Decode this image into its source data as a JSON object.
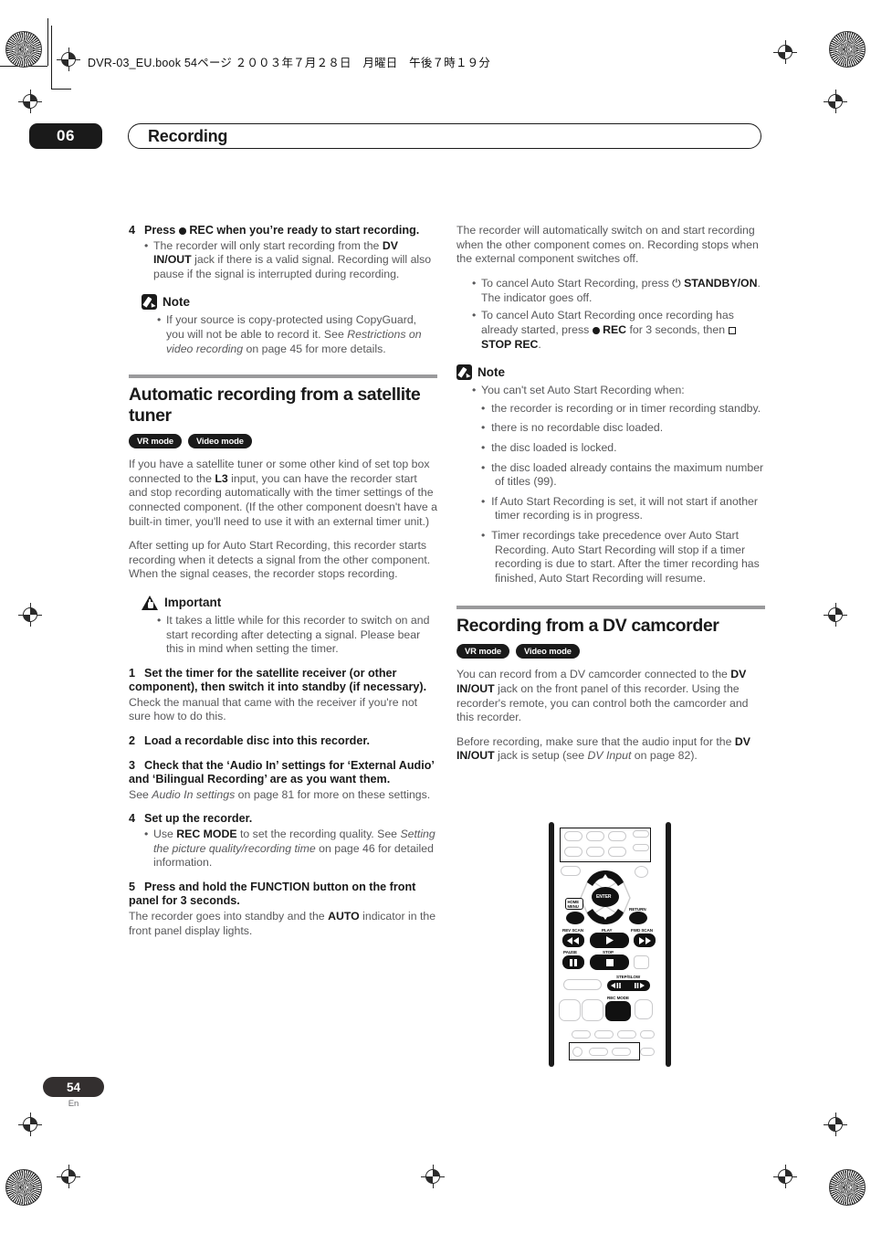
{
  "print": {
    "file_header": "DVR-03_EU.book  54ページ  ２００３年７月２８日　月曜日　午後７時１９分"
  },
  "header": {
    "chapter_number": "06",
    "chapter_title": "Recording"
  },
  "footer": {
    "page_number": "54",
    "language": "En"
  },
  "left_column": {
    "step4": {
      "number": "4",
      "title_a": "Press",
      "title_b": "REC when you’re ready to start recording.",
      "bullets": [
        "The recorder will only start recording from the DV IN/OUT jack if there is a valid signal. Recording will also pause if the signal is interrupted during recording."
      ]
    },
    "note1": {
      "label": "Note",
      "bullets": [
        "If your source is copy-protected using CopyGuard, you will not be able to record it. See Restrictions on video recording on page 45 for more details."
      ],
      "bullet1_pre": "If your source is copy-protected using CopyGuard, you will not be able to record it. See ",
      "bullet1_italic": "Restrictions on video recording",
      "bullet1_post": " on page 45 for more details."
    },
    "section": {
      "title": "Automatic recording from a satellite tuner",
      "badges": [
        "VR mode",
        "Video mode"
      ],
      "para1_a": "If you have a satellite tuner or some other kind of set top box connected to the ",
      "para1_bold": "L3",
      "para1_b": " input, you can have the recorder start and stop recording automatically with the timer settings of the connected component. (If the other component doesn't have a built-in timer, you'll need to use it with an external timer unit.)",
      "para2": "After setting up for Auto Start Recording, this recorder starts recording when it detects a signal from the other component. When the signal ceases, the recorder stops recording."
    },
    "important": {
      "label": "Important",
      "bullets": [
        "It takes a little while for this recorder to switch on and start recording after detecting a signal. Please bear this in mind when setting the timer."
      ]
    },
    "steps": [
      {
        "number": "1",
        "title": "Set the timer for the satellite receiver (or other component), then switch it into standby (if necessary).",
        "body": "Check the manual that came with the receiver if you're not sure how to do this."
      },
      {
        "number": "2",
        "title": "Load a recordable disc into this recorder.",
        "body": ""
      },
      {
        "number": "3",
        "title": "Check that the ‘Audio In’ settings for ‘External Audio’ and ‘Bilingual Recording’ are as you want them.",
        "body_pre": "See ",
        "body_italic": "Audio In settings",
        "body_post": " on page 81 for more on these settings."
      },
      {
        "number": "4",
        "title": "Set up the recorder.",
        "bullet_pre": "Use ",
        "bullet_bold": "REC MODE",
        "bullet_mid": " to set the recording quality. See ",
        "bullet_italic": "Setting the picture quality/recording time",
        "bullet_post": " on page 46 for detailed information."
      },
      {
        "number": "5",
        "title": "Press and hold the FUNCTION button on the front panel for 3 seconds.",
        "body_pre": "The recorder goes into standby and the ",
        "body_bold": "AUTO",
        "body_post": " indicator in the front panel display lights."
      }
    ]
  },
  "right_column": {
    "para1": "The recorder will automatically switch on and start recording when the other component comes on. Recording stops when the external component switches off.",
    "bullets": [
      {
        "pre": "To cancel Auto Start Recording, press ",
        "glyph": "standby-icon",
        "bold": "STANDBY/ON",
        "post": ". The indicator goes off."
      },
      {
        "pre": "To cancel Auto Start Recording once recording has already started, press ",
        "glyph": "rec-dot-icon",
        "bold": "REC",
        "mid": " for 3 seconds, then ",
        "glyph2": "stop-square-icon",
        "bold2": "STOP REC",
        "post": "."
      }
    ],
    "note": {
      "label": "Note",
      "intro": "You can't set Auto Start Recording when:",
      "subbullets": [
        "the recorder is recording or in timer recording standby.",
        "there is no recordable disc loaded.",
        "the disc loaded is locked.",
        "the disc loaded already contains the maximum number of titles (99).",
        "If Auto Start Recording is set, it will not start if another timer recording is in progress.",
        "Timer recordings take precedence over Auto Start Recording. Auto Start Recording will stop if a timer recording is due to start. After the timer recording has finished, Auto Start Recording will resume."
      ]
    },
    "section": {
      "title": "Recording from a DV camcorder",
      "badges": [
        "VR mode",
        "Video mode"
      ],
      "para1_pre": "You can record from a DV camcorder connected to the ",
      "para1_bold": "DV IN/OUT",
      "para1_post": " jack on the front panel of this recorder. Using the recorder's remote, you can control both the camcorder and this recorder.",
      "para2_pre": "Before recording, make sure that the audio input for the ",
      "para2_bold": "DV IN/OUT",
      "para2_mid": " jack is setup (see ",
      "para2_italic": "DV Input",
      "para2_post": " on page 82)."
    }
  },
  "remote": {
    "labels": {
      "home_menu": "HOME\nMENU",
      "home": "HOME",
      "menu": "MENU",
      "enter": "ENTER",
      "return": "RETURN",
      "rev_scan": "REV SCAN",
      "play": "PLAY",
      "fwd_scan": "FWD SCAN",
      "pause": "PAUSE",
      "stop": "STOP",
      "step_slow": "STEP/SLOW",
      "rec_mode": "REC MODE"
    }
  },
  "colors": {
    "text": "#58585a",
    "heading": "#1a1a1a",
    "rule": "#9a9a9c",
    "badge_bg": "#1a1a1a"
  }
}
